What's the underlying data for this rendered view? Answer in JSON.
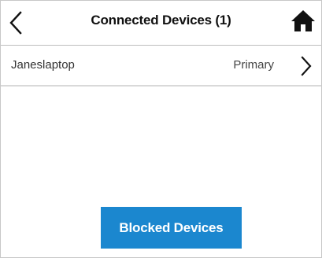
{
  "header": {
    "title": "Connected Devices (1)",
    "back_icon": "chevron-left-icon",
    "home_icon": "home-icon"
  },
  "devices": [
    {
      "name": "Janeslaptop",
      "status": "Primary",
      "action_icon": "chevron-right-icon"
    }
  ],
  "actions": {
    "blocked_devices_label": "Blocked Devices"
  },
  "colors": {
    "button_bg": "#1b87cf",
    "button_text": "#ffffff",
    "divider": "#d9d9d9"
  }
}
